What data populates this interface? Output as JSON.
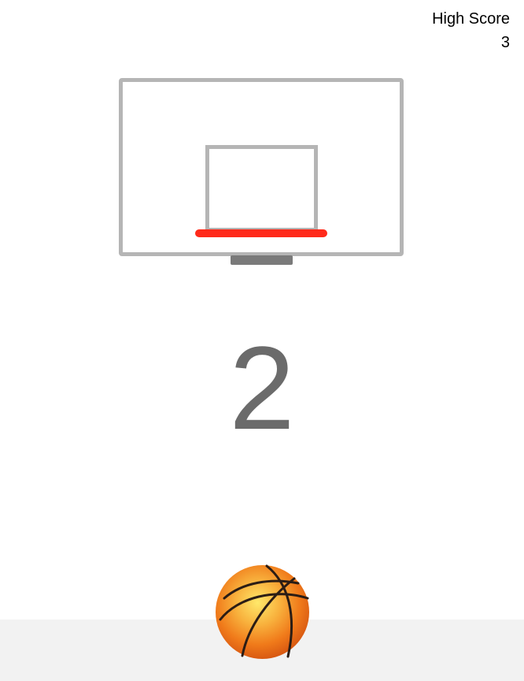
{
  "high_score": {
    "label": "High Score",
    "value": "3"
  },
  "score": {
    "value": "2"
  },
  "colors": {
    "backboard": "#b5b5b5",
    "rim": "#ff2a1a",
    "mount": "#7a7a7a",
    "score_text": "#6b6b6b",
    "floor": "#f2f2f2",
    "ball_highlight": "#ffe86a",
    "ball_base": "#f07a1a",
    "ball_seams": "#2b1d15"
  },
  "icons": {
    "ball": "basketball-icon"
  }
}
